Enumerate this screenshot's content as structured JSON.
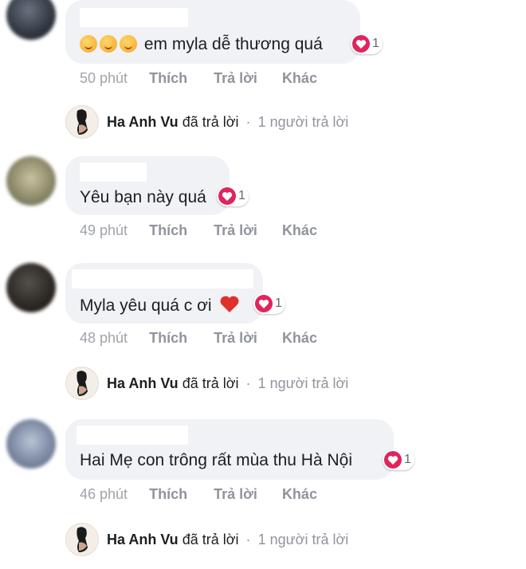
{
  "comments": [
    {
      "text": "em myla dễ thương quá",
      "emoji_prefix": [
        "smiling-face-icon",
        "smiling-face-icon",
        "smiling-face-icon"
      ],
      "reaction_count": "1",
      "time": "50 phút",
      "like": "Thích",
      "reply": "Trả lời",
      "more": "Khác"
    },
    {
      "text": "Yêu bạn này quá",
      "reaction_count": "1",
      "time": "49 phút",
      "like": "Thích",
      "reply": "Trả lời",
      "more": "Khác"
    },
    {
      "text": "Myla yêu quá c ơi",
      "trailing_emoji": "red-heart-icon",
      "reaction_count": "1",
      "time": "48 phút",
      "like": "Thích",
      "reply": "Trả lời",
      "more": "Khác"
    },
    {
      "text": "Hai Mẹ con trông rất mùa thu Hà Nội",
      "reaction_count": "1",
      "time": "46 phút",
      "like": "Thích",
      "reply": "Trả lời",
      "more": "Khác"
    }
  ],
  "replies": [
    {
      "name": "Ha Anh Vu",
      "verb": "đã trả lời",
      "separator": "·",
      "count": "1 người trả lời"
    },
    {
      "name": "Ha Anh Vu",
      "verb": "đã trả lời",
      "separator": "·",
      "count": "1 người trả lời"
    },
    {
      "name": "Ha Anh Vu",
      "verb": "đã trả lời",
      "separator": "·",
      "count": "1 người trả lời"
    }
  ],
  "colors": {
    "bubble": "#f0f2f5",
    "reaction": "#e0245e",
    "meta": "#90949c"
  }
}
